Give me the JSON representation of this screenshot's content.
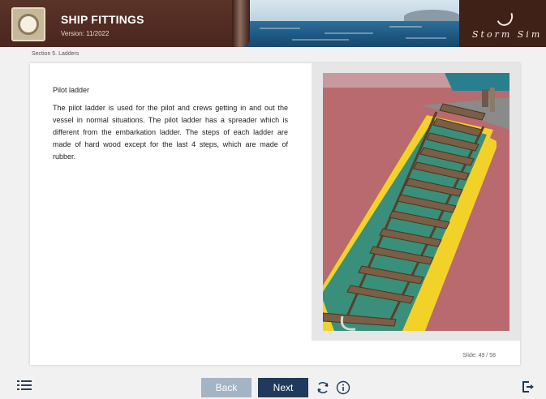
{
  "header": {
    "title": "SHIP FITTINGS",
    "version": "Version: 11/2022",
    "brand": "Storm Sim",
    "logo_icon": "ship-fitting-logo-icon"
  },
  "breadcrumb": "Section 5. Ladders",
  "slide": {
    "heading": "Pilot ladder",
    "body": "The pilot ladder is used for the pilot and crews getting in and out the vessel in normal situations. The pilot ladder has a spreader which is different from the embarkation ladder. The steps of each ladder are made of hard wood except for the last 4 steps, which are made of rubber.",
    "photo_icon": "pilot-ladder-photo",
    "counter": "Slide: 49 / 58"
  },
  "footer": {
    "menu_icon": "menu-list-icon",
    "back_label": "Back",
    "next_label": "Next",
    "reload_icon": "reload-icon",
    "info_icon": "info-icon",
    "exit_icon": "exit-icon"
  },
  "colors": {
    "header_bg": "#4a2a22",
    "next_button": "#1f3a5c",
    "back_button_disabled": "#a3b4c5",
    "deck_red": "#b86a6e",
    "deck_green": "#3a8f7a",
    "deck_yellow": "#f2d228"
  }
}
